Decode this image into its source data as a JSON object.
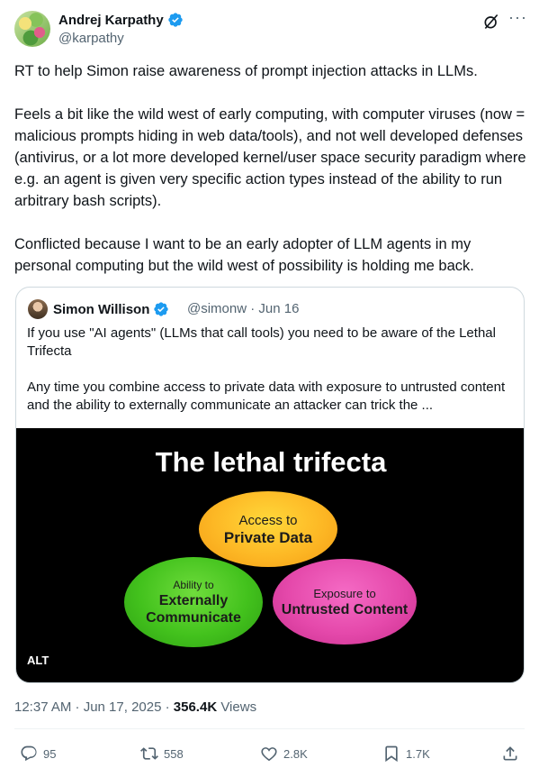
{
  "author": {
    "name": "Andrej Karpathy",
    "handle": "@karpathy"
  },
  "tweet": {
    "paragraphs": [
      "RT to help Simon raise awareness of prompt injection attacks in LLMs.",
      "Feels a bit like the wild west of early computing, with computer viruses (now = malicious prompts hiding in web data/tools), and not well developed defenses (antivirus, or a lot more developed kernel/user space security paradigm where e.g. an agent is given very specific action types instead of the ability to run arbitrary bash scripts).",
      "Conflicted because I want to be an early adopter of LLM agents in my personal computing but the wild west of possibility is holding me back."
    ]
  },
  "quote": {
    "name": "Simon Willison",
    "handle_date": "@simonw · Jun 16",
    "paragraphs": [
      "If you use \"AI agents\" (LLMs that call tools) you need to be aware of the Lethal Trifecta",
      "Any time you combine access to private data with exposure to untrusted content and the ability to externally communicate an attacker can trick the ..."
    ],
    "image": {
      "title": "The lethal trifecta",
      "access": {
        "line1": "Access to",
        "line2": "Private Data"
      },
      "external": {
        "line1": "Ability to",
        "line2a": "Externally",
        "line2b": "Communicate"
      },
      "untrusted": {
        "line1": "Exposure to",
        "line2": "Untrusted Content"
      },
      "alt_label": "ALT"
    }
  },
  "meta": {
    "timestamp": "12:37 AM · Jun 17, 2025 · ",
    "views_count": "356.4K",
    "views_label": " Views"
  },
  "actions": {
    "replies": "95",
    "retweets": "558",
    "likes": "2.8K",
    "bookmarks": "1.7K"
  },
  "colors": {
    "verified": "#1d9bf0",
    "secondary_text": "#536471",
    "border": "#cfd9de"
  }
}
